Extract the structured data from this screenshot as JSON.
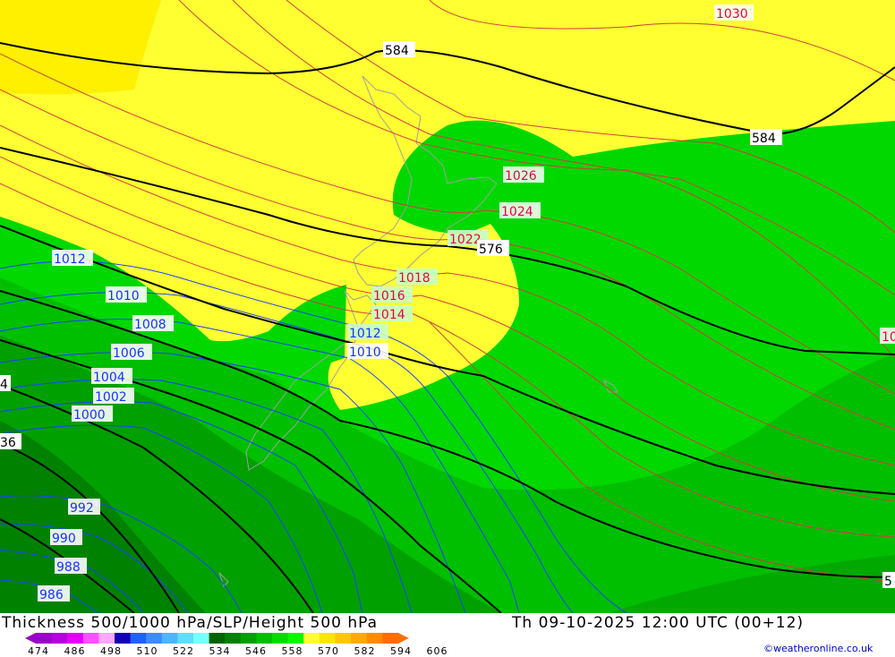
{
  "map": {
    "title": "Thickness 500/1000 hPa/SLP/Height 500 hPa",
    "valid_time": "Th 09-10-2025 12:00 UTC (00+12)",
    "credit": "©weatheronline.co.uk",
    "slp_red_labels": [
      "1030",
      "1026",
      "1024",
      "1022",
      "1018",
      "1016",
      "1014",
      "10"
    ],
    "slp_blue_labels": [
      "1012",
      "1010",
      "1008",
      "1006",
      "1004",
      "1002",
      "1000",
      "992",
      "990",
      "988",
      "986",
      "1012",
      "1010"
    ],
    "height_labels": [
      "584",
      "584",
      "576",
      "4",
      "36",
      "5"
    ],
    "scale_ticks": [
      "474",
      "486",
      "498",
      "510",
      "522",
      "534",
      "546",
      "558",
      "570",
      "582",
      "594",
      "606"
    ],
    "scale_colors": [
      "#9b00c8",
      "#b400dc",
      "#e000ff",
      "#ff50ff",
      "#ffa8ff",
      "#1400b4",
      "#2060ff",
      "#3c8cff",
      "#50b4ff",
      "#64dcff",
      "#78ffff",
      "#006400",
      "#008200",
      "#00a000",
      "#00be00",
      "#00dc00",
      "#00fa00",
      "#ffff32",
      "#ffe600",
      "#ffc800",
      "#ffaa00",
      "#ff8c00",
      "#ff6e00"
    ]
  }
}
